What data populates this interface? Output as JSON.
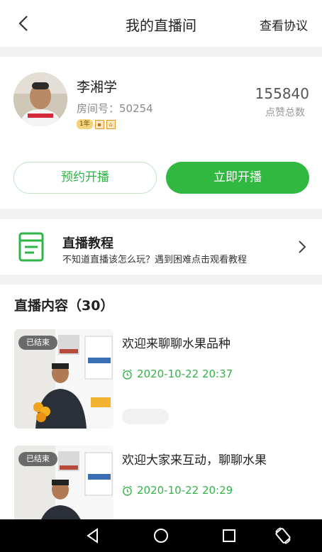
{
  "header": {
    "title": "我的直播间",
    "agreement_label": "查看协议"
  },
  "profile": {
    "name": "李湘学",
    "room": "房间号：50254",
    "badge_level": "1年",
    "likes_count": "155840",
    "likes_label": "点赞总数"
  },
  "actions": {
    "reserve_label": "预约开播",
    "live_label": "立即开播"
  },
  "tutorial": {
    "title": "直播教程",
    "desc": "不知道直播该怎么玩？遇到困难点击观看教程"
  },
  "content": {
    "title": "直播内容（30）",
    "items": [
      {
        "status": "已结束",
        "title": "欢迎来聊聊水果品种",
        "time": "2020-10-22 20:37"
      },
      {
        "status": "已结束",
        "title": "欢迎大家来互动，聊聊水果",
        "time": "2020-10-22 20:29"
      }
    ]
  },
  "colors": {
    "accent": "#31b840",
    "time_green": "#36b24a"
  }
}
